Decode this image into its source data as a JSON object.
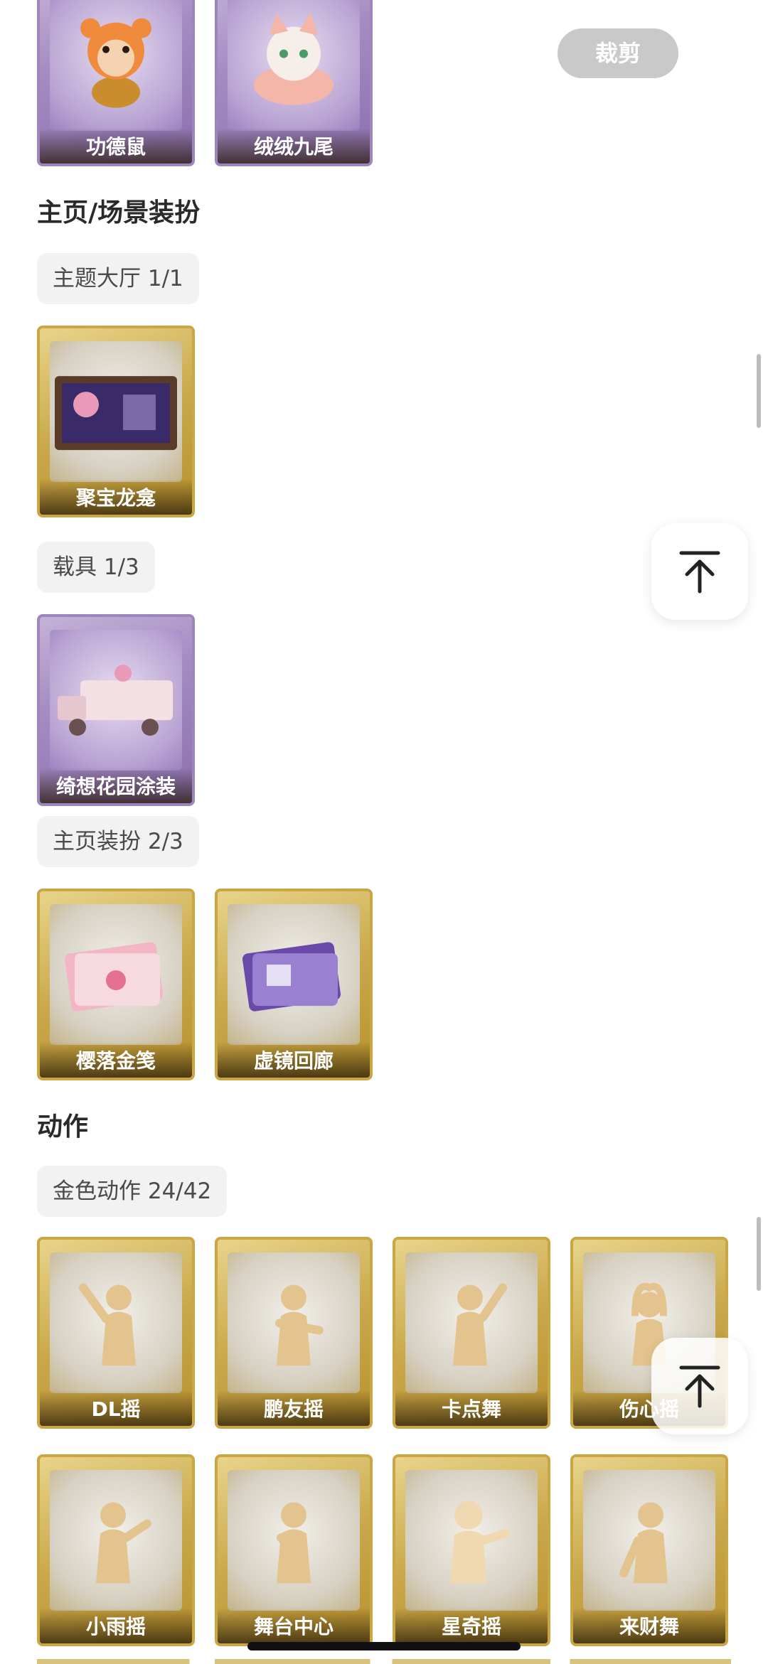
{
  "crop_button": "裁剪",
  "sections": {
    "home_scene": "主页/场景装扮",
    "actions": "动作"
  },
  "chips": {
    "theme_hall": "主题大厅 1/1",
    "vehicle": "载具 1/3",
    "home_dress": "主页装扮 2/3",
    "gold_actions": "金色动作 24/42"
  },
  "cards": {
    "top": [
      {
        "label": "功德鼠",
        "icon": "mouse-character-icon"
      },
      {
        "label": "绒绒九尾",
        "icon": "fox-character-icon"
      }
    ],
    "theme_hall": [
      {
        "label": "聚宝龙龛",
        "icon": "scene-icon"
      }
    ],
    "vehicle": [
      {
        "label": "绮想花园涂装",
        "icon": "vehicle-icon"
      }
    ],
    "home_dress": [
      {
        "label": "樱落金笺",
        "icon": "card-pink-icon"
      },
      {
        "label": "虚镜回廊",
        "icon": "card-purple-icon"
      }
    ],
    "actions_row1": [
      {
        "label": "DL摇"
      },
      {
        "label": "鹏友摇"
      },
      {
        "label": "卡点舞"
      },
      {
        "label": "伤心摇"
      }
    ],
    "actions_row2": [
      {
        "label": "小雨摇"
      },
      {
        "label": "舞台中心"
      },
      {
        "label": "星奇摇"
      },
      {
        "label": "来财舞"
      }
    ]
  },
  "icons": {
    "back_to_top": "arrow-up-to-top-icon"
  },
  "colors": {
    "purple_card": "#a48cc2",
    "gold_card": "#c9a84a",
    "chip_bg": "#f2f2f2"
  }
}
